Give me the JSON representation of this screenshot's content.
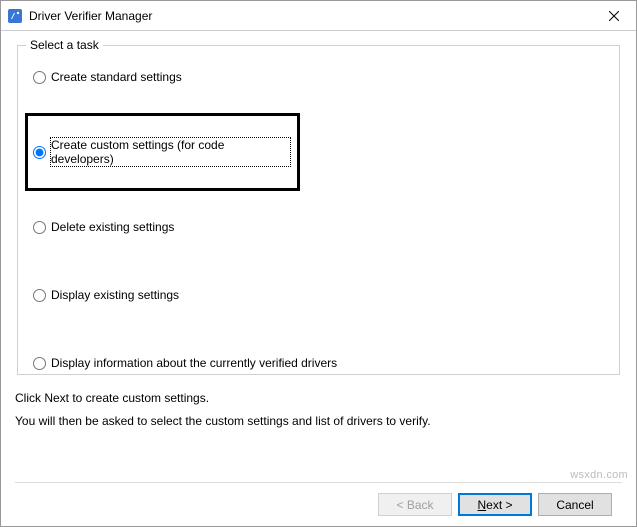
{
  "window": {
    "title": "Driver Verifier Manager"
  },
  "groupbox": {
    "label": "Select a task",
    "options": [
      {
        "label": "Create standard settings",
        "checked": false
      },
      {
        "label": "Create custom settings (for code developers)",
        "checked": true,
        "highlighted": true
      },
      {
        "label": "Delete existing settings",
        "checked": false
      },
      {
        "label": "Display existing settings",
        "checked": false
      },
      {
        "label": "Display information about the currently verified drivers",
        "checked": false
      }
    ]
  },
  "instructions": {
    "line1": "Click Next to create custom settings.",
    "line2": "You will then be asked to select the custom settings and list of drivers to verify."
  },
  "buttons": {
    "back": "< Back",
    "next_prefix": "N",
    "next_rest": "ext >",
    "cancel": "Cancel"
  },
  "watermark": "wsxdn.com"
}
